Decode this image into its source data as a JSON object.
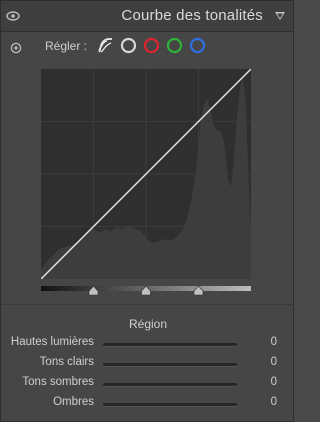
{
  "header": {
    "title": "Courbe des tonalités"
  },
  "adjust": {
    "label": "Régler :",
    "channels": [
      {
        "name": "parametric",
        "icon": "parametric-curve-icon"
      },
      {
        "name": "point-rgb",
        "color": "#d8d8d8"
      },
      {
        "name": "point-red",
        "color": "#e0242c"
      },
      {
        "name": "point-green",
        "color": "#2fb33b"
      },
      {
        "name": "point-blue",
        "color": "#2f6fe6"
      }
    ]
  },
  "region": {
    "title": "Région",
    "split_points": [
      0.25,
      0.5,
      0.75
    ],
    "sliders": [
      {
        "label": "Hautes lumières",
        "value": "0",
        "level": 0.5
      },
      {
        "label": "Tons clairs",
        "value": "0",
        "level": 0.5
      },
      {
        "label": "Tons sombres",
        "value": "0",
        "level": 0.5
      },
      {
        "label": "Ombres",
        "value": "0",
        "level": 0.5
      }
    ]
  }
}
